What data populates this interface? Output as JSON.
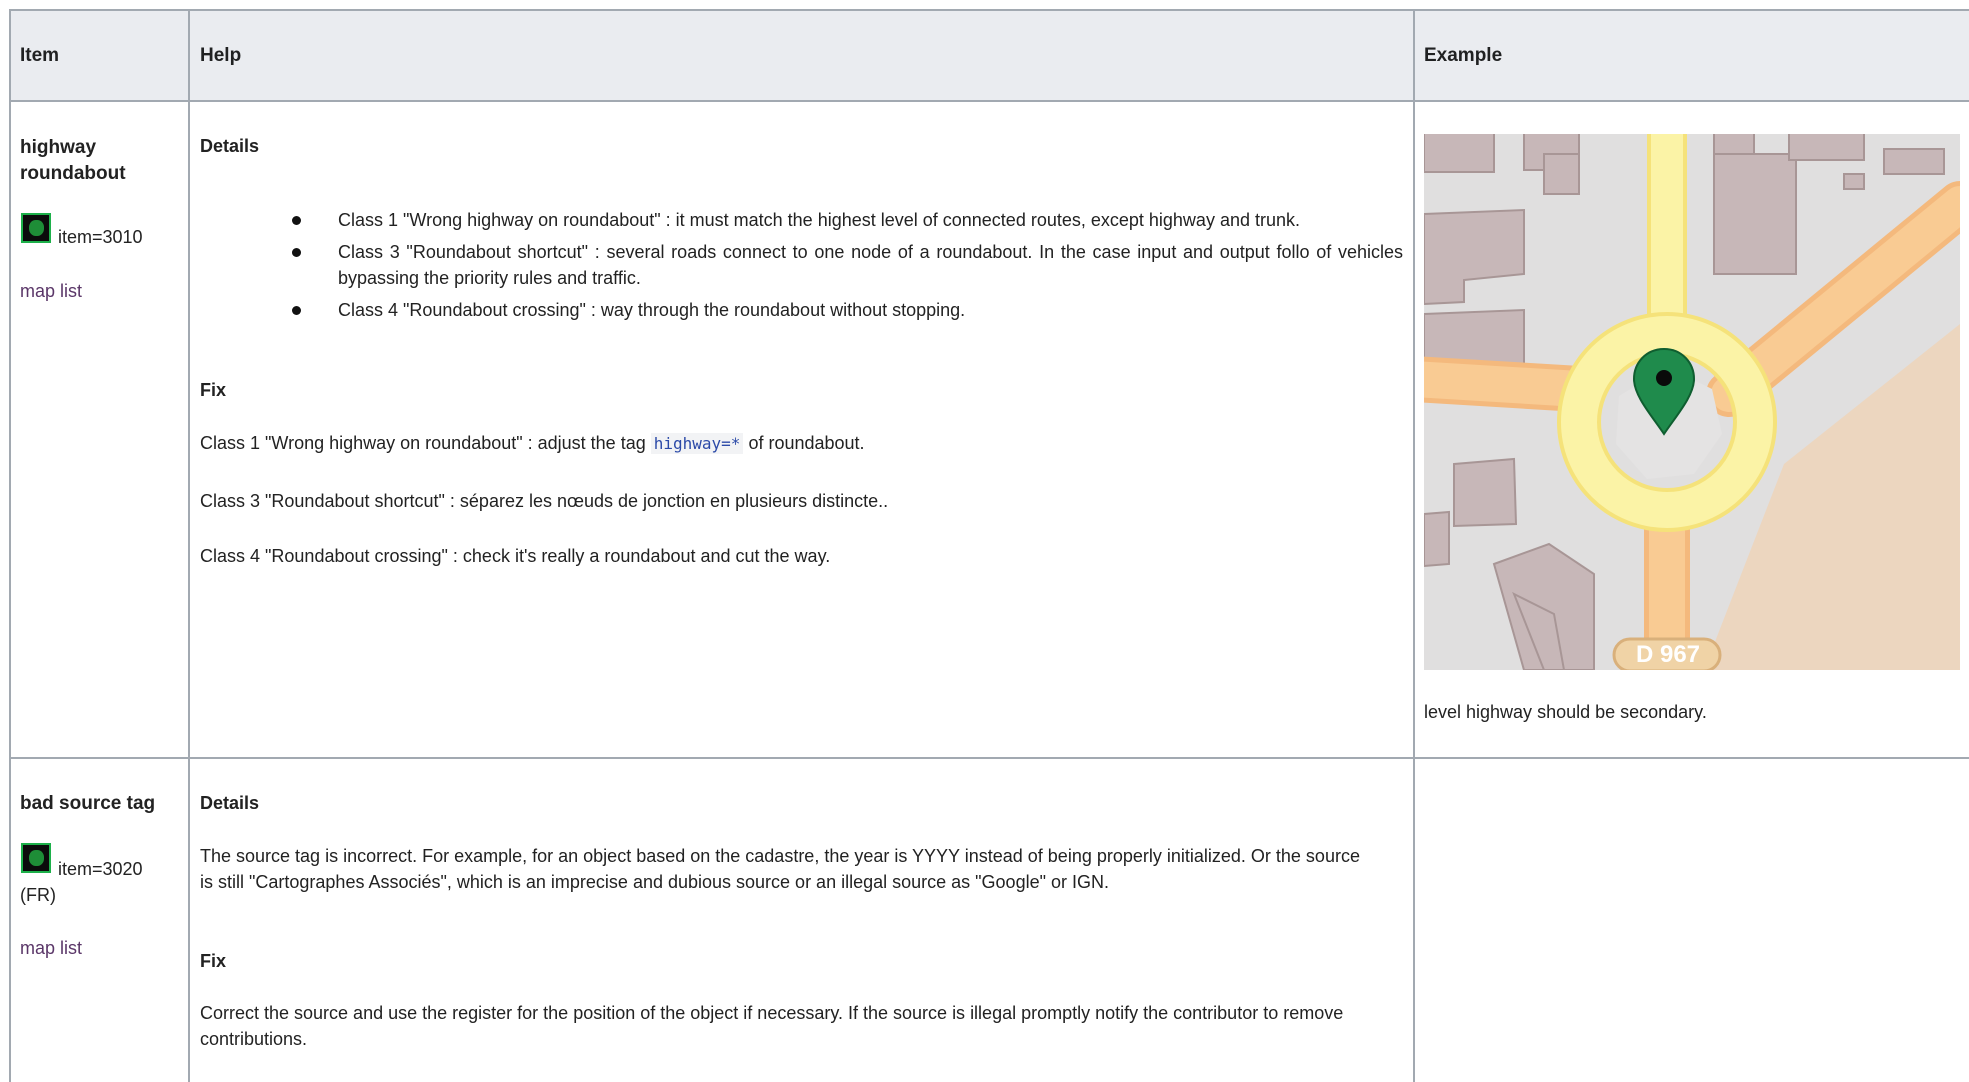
{
  "header": {
    "col_item": "Item",
    "col_help": "Help",
    "col_example": "Example"
  },
  "rows": [
    {
      "item_title": "highway roundabout",
      "item_code": "item=3010",
      "item_link": "map list",
      "details_heading": "Details",
      "bullets": [
        "Class 1 \"Wrong highway on roundabout\" : it must match the highest level of connected routes, except highway and trunk.",
        "Class 3 \"Roundabout shortcut\" : several roads connect to one node of a roundabout. In the case input and output follo of vehicles bypassing the priority rules and traffic.",
        "Class 4 \"Roundabout crossing\" : way through the roundabout without stopping."
      ],
      "fix_heading": "Fix",
      "fix_1_before": "Class 1 \"Wrong highway on roundabout\" : adjust the tag ",
      "fix_1_code": "highway=*",
      "fix_1_after": " of roundabout.",
      "fix_3": "Class 3 \"Roundabout shortcut\" : séparez les nœuds de jonction en plusieurs distincte..",
      "fix_4": "Class 4 \"Roundabout crossing\" : check it's really a roundabout and cut the way.",
      "example_map_label": "D 967",
      "example_caption": "level highway should be secondary."
    },
    {
      "item_title": "bad source tag",
      "item_code": "item=3020",
      "item_region": "(FR)",
      "item_link": "map list",
      "details_heading": "Details",
      "details_text": "The source tag is incorrect. For example, for an object based on the cadastre, the year is YYYY instead of being properly initialized. Or the source is still \"Cartographes Associés\", which is an imprecise and dubious source or an illegal source as \"Google\" or IGN.",
      "fix_heading": "Fix",
      "fix_text": "Correct the source and use the register for the position of the object if necessary. If the source is illegal promptly notify the contributor to remove contributions."
    }
  ],
  "colors": {
    "border": "#a2a9b1",
    "header_bg": "#eaecf0",
    "link": "#5a3668",
    "code": "#2c4aa8",
    "map_bg": "#e0dfdf",
    "building": "#c5b5b5",
    "road_secondary": "#f7c88e",
    "road_primary": "#fbf19c",
    "marker": "#1f8b4c"
  }
}
